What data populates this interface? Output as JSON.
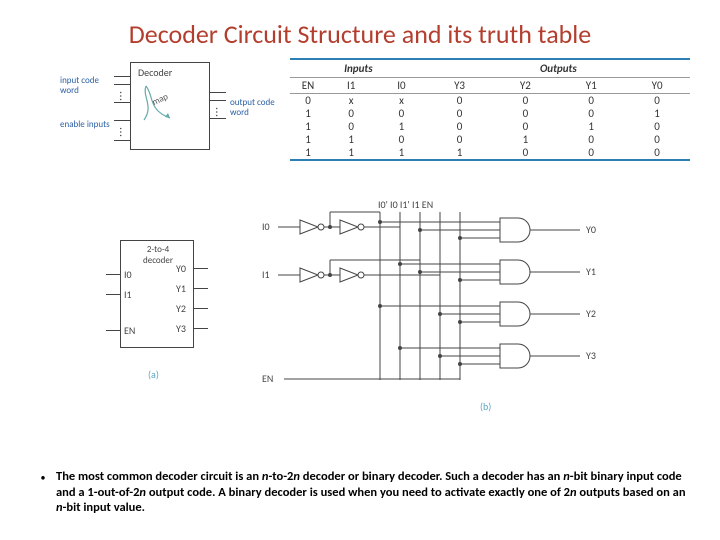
{
  "title": "Decoder Circuit Structure and its truth table",
  "block_diagram": {
    "box_label": "Decoder",
    "map_label": "map",
    "input_code_label": "input\ncode word",
    "enable_label": "enable\ninputs",
    "output_code_label": "output\ncode word"
  },
  "truth_table": {
    "group_inputs": "Inputs",
    "group_outputs": "Outputs",
    "headers": [
      "EN",
      "I1",
      "I0",
      "Y3",
      "Y2",
      "Y1",
      "Y0"
    ],
    "rows": [
      [
        "0",
        "x",
        "x",
        "0",
        "0",
        "0",
        "0"
      ],
      [
        "1",
        "0",
        "0",
        "0",
        "0",
        "0",
        "1"
      ],
      [
        "1",
        "0",
        "1",
        "0",
        "0",
        "1",
        "0"
      ],
      [
        "1",
        "1",
        "0",
        "0",
        "1",
        "0",
        "0"
      ],
      [
        "1",
        "1",
        "1",
        "1",
        "0",
        "0",
        "0"
      ]
    ]
  },
  "decoder_2to4": {
    "title": "2-to-4\ndecoder",
    "left_pins": [
      "I0",
      "I1",
      "EN"
    ],
    "right_pins": [
      "Y0",
      "Y1",
      "Y2",
      "Y3"
    ],
    "caption": "(a)"
  },
  "schematic": {
    "top_labels": "I0'  I0 I1'  I1 EN",
    "inputs": [
      "I0",
      "I1",
      "EN"
    ],
    "outputs": [
      "Y0",
      "Y1",
      "Y2",
      "Y3"
    ],
    "caption": "(b)"
  },
  "bullet": {
    "mark": "•",
    "text_parts": {
      "a": "The most common decoder circuit is an ",
      "b": "n",
      "c": "-to-2",
      "d": "n",
      "e": " decoder or binary decoder. Such a decoder has an ",
      "f": "n",
      "g": "-bit binary input code and a 1-out-of-2",
      "h": "n",
      "i": " output code. A binary decoder is used when you need to activate exactly one of 2",
      "j": "n",
      "k": " outputs based on an ",
      "l": "n",
      "m": "-bit input value."
    }
  }
}
